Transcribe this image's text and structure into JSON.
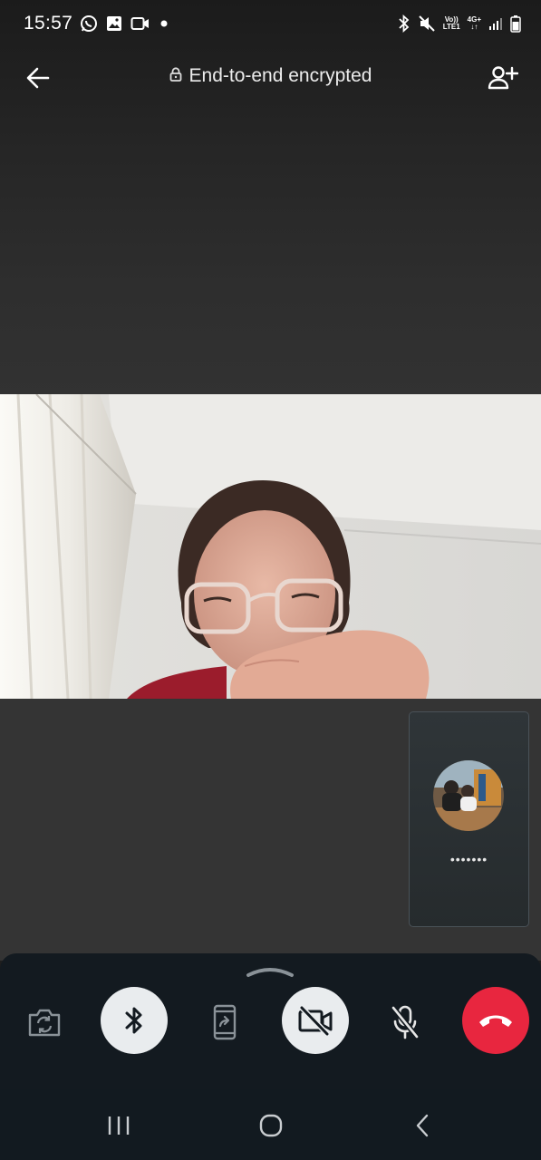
{
  "status_bar": {
    "time": "15:57",
    "left_icons": [
      "whatsapp-icon",
      "gallery-icon",
      "video-record-icon",
      "notification-dot-icon"
    ],
    "volte_label_top": "Vo))",
    "volte_label_bottom": "LTE1",
    "network_label": "4G+",
    "right_icons": [
      "bluetooth-icon",
      "mute-icon",
      "volte-icon",
      "network-4g-icon",
      "signal-icon",
      "battery-icon"
    ]
  },
  "header": {
    "title": "End-to-end encrypted",
    "back_icon": "back-arrow-icon",
    "lock_icon": "lock-icon",
    "add_participant_icon": "add-person-icon"
  },
  "self_preview": {
    "status_text": "•••••••"
  },
  "controls": [
    {
      "name": "flip-camera-button",
      "icon": "camera-flip-icon",
      "style": "plain"
    },
    {
      "name": "bluetooth-audio-button",
      "icon": "bluetooth-icon",
      "style": "circle"
    },
    {
      "name": "share-screen-button",
      "icon": "screen-share-icon",
      "style": "plain"
    },
    {
      "name": "camera-off-button",
      "icon": "video-off-icon",
      "style": "circle"
    },
    {
      "name": "mute-mic-button",
      "icon": "mic-off-icon",
      "style": "plain"
    },
    {
      "name": "end-call-button",
      "icon": "phone-hangup-icon",
      "style": "end"
    }
  ],
  "colors": {
    "end_call": "#e8263f",
    "panel": "#131a20",
    "toggle_on": "#e9ecee",
    "icon_dim": "#8a9298"
  }
}
